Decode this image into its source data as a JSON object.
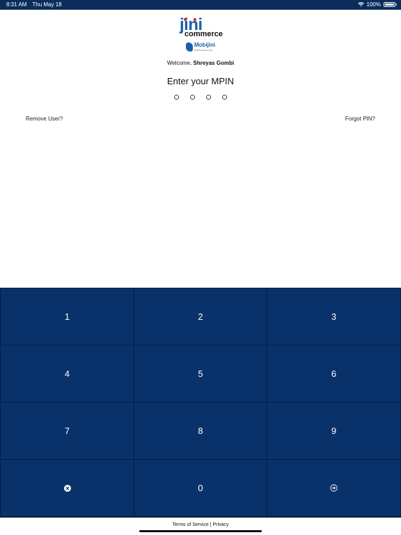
{
  "status_bar": {
    "time": "8:31 AM",
    "date": "Thu May 18",
    "battery": "100%",
    "battery_level": 1.0
  },
  "brand": {
    "logo_word": "jini",
    "logo_subword": "commerce",
    "badge_name": "Mobijini",
    "badge_tagline": "Mobility Digital Jinie",
    "primary_color": "#09316a",
    "accent_color": "#1b5fa8",
    "dot_color": "#e11d2a"
  },
  "welcome": {
    "prefix": "Welcome,",
    "user_name": "Shreyas Gombi"
  },
  "mpin": {
    "title": "Enter your MPIN",
    "length": 4,
    "filled": 0
  },
  "links": {
    "remove_user": "Remove User?",
    "forgot_pin": "Forgot PIN?"
  },
  "keypad": {
    "keys": [
      "1",
      "2",
      "3",
      "4",
      "5",
      "6",
      "7",
      "8",
      "9"
    ],
    "zero": "0",
    "delete_icon": "close-circle-icon",
    "submit_icon": "enter-arrow-icon"
  },
  "footer": {
    "terms": "Terms of Service",
    "separator": "|",
    "privacy": "Privacy"
  }
}
